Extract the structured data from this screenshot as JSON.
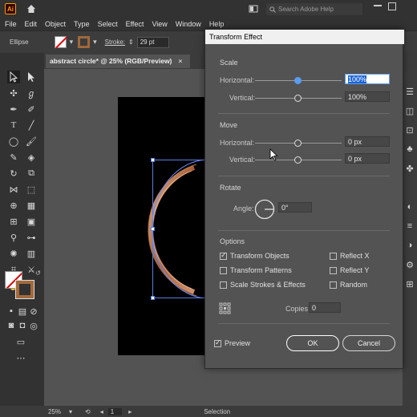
{
  "app": {
    "logo": "Ai",
    "search_placeholder": "Search Adobe Help"
  },
  "menu": [
    "File",
    "Edit",
    "Object",
    "Type",
    "Select",
    "Effect",
    "View",
    "Window",
    "Help"
  ],
  "control": {
    "selection_label": "Ellipse",
    "stroke_label": "Stroke:",
    "stroke_value": "29 pt"
  },
  "document": {
    "tab_title": "abstract circle* @ 25% (RGB/Preview)"
  },
  "status": {
    "zoom": "25%",
    "artboard": "1",
    "tool": "Selection"
  },
  "dialog": {
    "title": "Transform Effect",
    "scale": {
      "title": "Scale",
      "h_label": "Horizontal:",
      "h_value": "100%",
      "v_label": "Vertical:",
      "v_value": "100%"
    },
    "move": {
      "title": "Move",
      "h_label": "Horizontal:",
      "h_value": "0 px",
      "v_label": "Vertical:",
      "v_value": "0 px"
    },
    "rotate": {
      "title": "Rotate",
      "angle_label": "Angle:",
      "angle_value": "0°"
    },
    "options": {
      "title": "Options",
      "transform_objects": "Transform Objects",
      "transform_patterns": "Transform Patterns",
      "scale_strokes": "Scale Strokes & Effects",
      "reflect_x": "Reflect X",
      "reflect_y": "Reflect Y",
      "random": "Random"
    },
    "copies_label": "Copies",
    "copies_value": "0",
    "preview_label": "Preview",
    "ok_label": "OK",
    "cancel_label": "Cancel"
  }
}
